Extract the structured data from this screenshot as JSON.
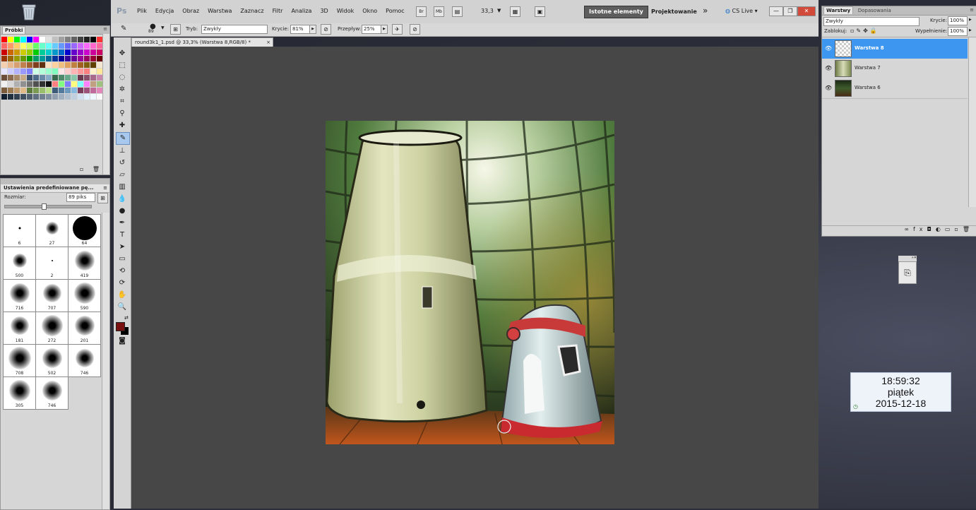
{
  "app": {
    "logo": "Ps",
    "accent": "#3d97f0"
  },
  "menubar": {
    "items": [
      "Plik",
      "Edycja",
      "Obraz",
      "Warstwa",
      "Zaznacz",
      "Filtr",
      "Analiza",
      "3D",
      "Widok",
      "Okno",
      "Pomoc"
    ],
    "bridge": "Br",
    "minibridge": "Mb",
    "zoom_value": "33,3",
    "workspace_active": "Istotne elementy",
    "workspace_other": "Projektowanie",
    "more": "»",
    "cslive": "CS Live"
  },
  "options": {
    "brush_size": "89",
    "mode_label": "Tryb:",
    "mode_value": "Zwykły",
    "opacity_label": "Krycie:",
    "opacity_value": "81%",
    "flow_label": "Przepływ:",
    "flow_value": "25%"
  },
  "document": {
    "tab_title": "round3k1_1.psd @ 33,3% (Warstwa 8,RGB/8) *",
    "close": "×"
  },
  "swatches_panel": {
    "title": "Próbki",
    "colors": [
      "#ff0000",
      "#ffff00",
      "#00ff00",
      "#00ffff",
      "#0000ff",
      "#ff00ff",
      "#ffffff",
      "#e0e0e0",
      "#c0c0c0",
      "#a0a0a0",
      "#808080",
      "#606060",
      "#404040",
      "#202020",
      "#000000",
      "#ff3333",
      "#ff9933",
      "#ff6666",
      "#ff9966",
      "#ffcc66",
      "#ffff66",
      "#ccff66",
      "#66ff66",
      "#66ffcc",
      "#66ffff",
      "#66ccff",
      "#6699ff",
      "#6666ff",
      "#9966ff",
      "#cc66ff",
      "#ff66ff",
      "#ff66cc",
      "#ff6699",
      "#cc3333",
      "#cc0000",
      "#cc6600",
      "#cc9900",
      "#cccc00",
      "#99cc00",
      "#00cc00",
      "#00cc99",
      "#00cccc",
      "#0099cc",
      "#0066cc",
      "#0000cc",
      "#6600cc",
      "#9900cc",
      "#cc00cc",
      "#cc0099",
      "#cc0066",
      "#990000",
      "#993300",
      "#996600",
      "#999900",
      "#669900",
      "#009900",
      "#009966",
      "#009999",
      "#006699",
      "#003399",
      "#000099",
      "#330099",
      "#660099",
      "#990099",
      "#990066",
      "#990033",
      "#660000",
      "#663300",
      "#f5d0b0",
      "#e8b890",
      "#d8a070",
      "#c08050",
      "#a06030",
      "#804020",
      "#603010",
      "#ffe0c0",
      "#ffd0a0",
      "#f0c080",
      "#e0a060",
      "#c08040",
      "#a06020",
      "#806010",
      "#604000",
      "#f2e6d0",
      "#d9c9a8",
      "#e6e6ff",
      "#ccccff",
      "#b3b3ff",
      "#9999ff",
      "#8080ff",
      "#ccffe6",
      "#b3ffd9",
      "#99ffcc",
      "#80ffbf",
      "#ffe6e6",
      "#ffcccc",
      "#ffb3b3",
      "#ff9999",
      "#ff8080",
      "#fff0cc",
      "#ffe699",
      "#ffdb66",
      "#6b4f3a",
      "#8a6b4f",
      "#a88b6a",
      "#c7ab88",
      "#3a4f6b",
      "#4f6b8a",
      "#6a8ba8",
      "#88abc7",
      "#3a6b4f",
      "#4f8a6b",
      "#6aa88b",
      "#88c7ab",
      "#6b3a4f",
      "#8a4f6b",
      "#a86a8b",
      "#c788ab",
      "#222222",
      "#f0f0f0",
      "#d8d8d8",
      "#b0b0b0",
      "#909090",
      "#707070",
      "#505050",
      "#303030",
      "#101010",
      "#ff8080",
      "#80ff80",
      "#8080ff",
      "#ffff80",
      "#80ffff",
      "#ff80ff",
      "#c0a080",
      "#a0c080",
      "#80a0c0",
      "#7a5c3c",
      "#9c7a52",
      "#bf9a6c",
      "#e0ba88",
      "#5c7a3c",
      "#7a9c52",
      "#9abf6c",
      "#bae088",
      "#3c5c7a",
      "#527a9c",
      "#6c9abf",
      "#88bae0",
      "#7a3c5c",
      "#9c527a",
      "#bf6c9a",
      "#e088ba",
      "#444444",
      "#102030",
      "#203040",
      "#304050",
      "#405060",
      "#506070",
      "#607080",
      "#708090",
      "#8090a0",
      "#90a0b0",
      "#a0b0c0",
      "#b0c0d0",
      "#c0d0e0",
      "#d0e0f0",
      "#e0f0ff",
      "#f0f8ff",
      "#fafafa",
      "#eeeeee"
    ]
  },
  "brush_presets_panel": {
    "title": "Ustawienia predefiniowane pę...",
    "size_label": "Rozmiar:",
    "size_value": "89 piks",
    "brushes": [
      {
        "n": "6",
        "d": 3,
        "soft": false
      },
      {
        "n": "27",
        "d": 18,
        "soft": true
      },
      {
        "n": "64",
        "d": 34,
        "soft": false
      },
      {
        "n": "500",
        "d": 20,
        "soft": true
      },
      {
        "n": "2",
        "d": 2,
        "soft": false
      },
      {
        "n": "419",
        "d": 28,
        "soft": true
      },
      {
        "n": "716",
        "d": 28,
        "soft": true
      },
      {
        "n": "707",
        "d": 26,
        "soft": true
      },
      {
        "n": "590",
        "d": 30,
        "soft": true
      },
      {
        "n": "181",
        "d": 26,
        "soft": true
      },
      {
        "n": "272",
        "d": 30,
        "soft": true
      },
      {
        "n": "201",
        "d": 28,
        "soft": true
      },
      {
        "n": "708",
        "d": 32,
        "soft": true
      },
      {
        "n": "502",
        "d": 28,
        "soft": true
      },
      {
        "n": "746",
        "d": 26,
        "soft": true
      },
      {
        "n": "305",
        "d": 30,
        "soft": true
      },
      {
        "n": "746",
        "d": 28,
        "soft": true
      }
    ]
  },
  "layers_panel": {
    "tab_active": "Warstwy",
    "tab_other": "Dopasowania",
    "blend_mode": "Zwykły",
    "opacity_label": "Krycie:",
    "opacity_value": "100%",
    "lock_label": "Zablokuj:",
    "fill_label": "Wypełnienie:",
    "fill_value": "100%",
    "layers": [
      {
        "name": "Warstwa 8",
        "selected": true
      },
      {
        "name": "Warstwa 7",
        "selected": false
      },
      {
        "name": "Warstwa 6",
        "selected": false
      }
    ]
  },
  "clock_widget": {
    "time": "18:59:32",
    "day": "piątek",
    "date": "2015-12-18"
  },
  "window_controls": {
    "minimize": "—",
    "restore": "❐",
    "close": "✕"
  }
}
